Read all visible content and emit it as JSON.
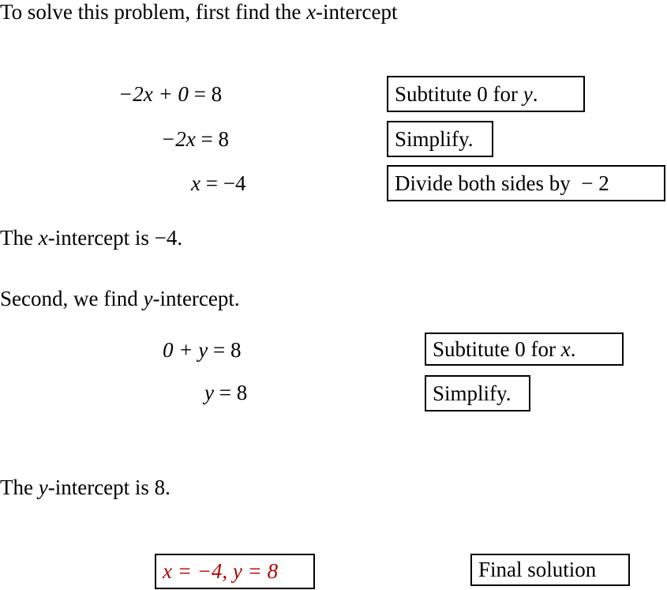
{
  "intro": {
    "before": "To solve this problem, first find the ",
    "var": "x",
    "after": "-intercept"
  },
  "x_steps": [
    {
      "lhs": "−2x + 0",
      "rhs": "8",
      "note": "Subtitute 0 for ",
      "note_var": "y",
      "note_end": "."
    },
    {
      "lhs": "−2x",
      "rhs": "8",
      "note": "Simplify.",
      "note_var": "",
      "note_end": ""
    },
    {
      "lhs": "x",
      "rhs": "−4",
      "note": "Divide both sides by  − 2",
      "note_var": "",
      "note_end": ""
    }
  ],
  "x_result": {
    "before": "The ",
    "var": "x",
    "after": "-intercept is −4."
  },
  "second": {
    "before": "Second, we find ",
    "var": "y",
    "after": "-intercept."
  },
  "y_steps": [
    {
      "lhs": "0 + y",
      "rhs": "8",
      "note": "Subtitute 0 for ",
      "note_var": "x",
      "note_end": "."
    },
    {
      "lhs": "y",
      "rhs": "8",
      "note": "Simplify.",
      "note_var": "",
      "note_end": ""
    }
  ],
  "y_result": {
    "before": "The ",
    "var": "y",
    "after": "-intercept is 8."
  },
  "final": {
    "answer": "x = −4, y = 8",
    "label": "Final solution",
    "answer_color": "#b00000"
  }
}
